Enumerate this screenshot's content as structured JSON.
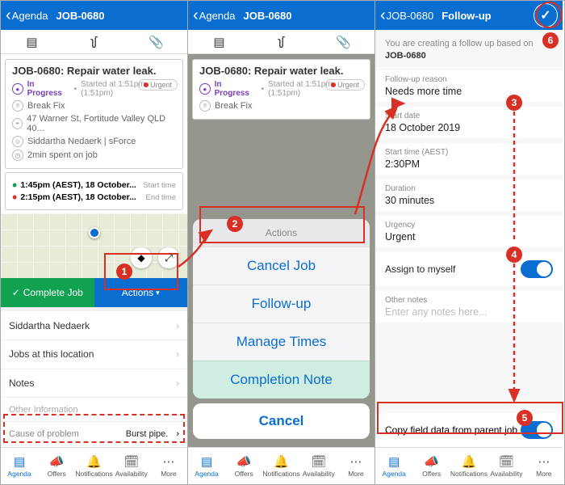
{
  "screen1": {
    "header": {
      "back": "Agenda",
      "title": "JOB-0680"
    },
    "job": {
      "title": "JOB-0680: Repair water leak.",
      "status": "In Progress",
      "status_time": "Started at 1:51pm (1:51pm)",
      "urgent": "Urgent",
      "category": "Break Fix",
      "address": "47 Warner St, Fortitude Valley QLD 40...",
      "contact": "Siddartha Nedaerk | sForce",
      "spent": "2min spent on job"
    },
    "times": {
      "start_value": "1:45pm (AEST), 18 October...",
      "start_label": "Start time",
      "end_value": "2:15pm (AEST), 18 October...",
      "end_label": "End time"
    },
    "buttons": {
      "complete": "Complete Job",
      "actions": "Actions"
    },
    "sections": {
      "person": "Siddartha Nedaerk",
      "jobs_loc": "Jobs at this location",
      "notes": "Notes",
      "other": "Other Information",
      "cause_label": "Cause of problem",
      "cause_value": "Burst pipe."
    }
  },
  "screen2": {
    "header": {
      "back": "Agenda",
      "title": "JOB-0680"
    },
    "sheet": {
      "title": "Actions",
      "cancel_job": "Cancel Job",
      "follow_up": "Follow-up",
      "manage_times": "Manage Times",
      "completion_note": "Completion Note",
      "cancel": "Cancel"
    }
  },
  "screen3": {
    "header": {
      "back": "JOB-0680",
      "title": "Follow-up"
    },
    "intro_prefix": "You are creating a follow up based on ",
    "intro_job": "JOB-0680",
    "form": {
      "reason_label": "Follow-up reason",
      "reason_value": "Needs more time",
      "date_label": "Start date",
      "date_value": "18 October 2019",
      "time_label": "Start time (AEST)",
      "time_value": "2:30PM",
      "duration_label": "Duration",
      "duration_value": "30 minutes",
      "urgency_label": "Urgency",
      "urgency_value": "Urgent",
      "assign_label": "Assign to myself",
      "notes_label": "Other notes",
      "notes_placeholder": "Enter any notes here...",
      "copy_label": "Copy field data from parent job"
    }
  },
  "nav": {
    "agenda": "Agenda",
    "offers": "Offers",
    "notifications": "Notifications",
    "availability": "Availability",
    "more": "More"
  },
  "annotations": {
    "n1": "1",
    "n2": "2",
    "n3": "3",
    "n4": "4",
    "n5": "5",
    "n6": "6"
  }
}
